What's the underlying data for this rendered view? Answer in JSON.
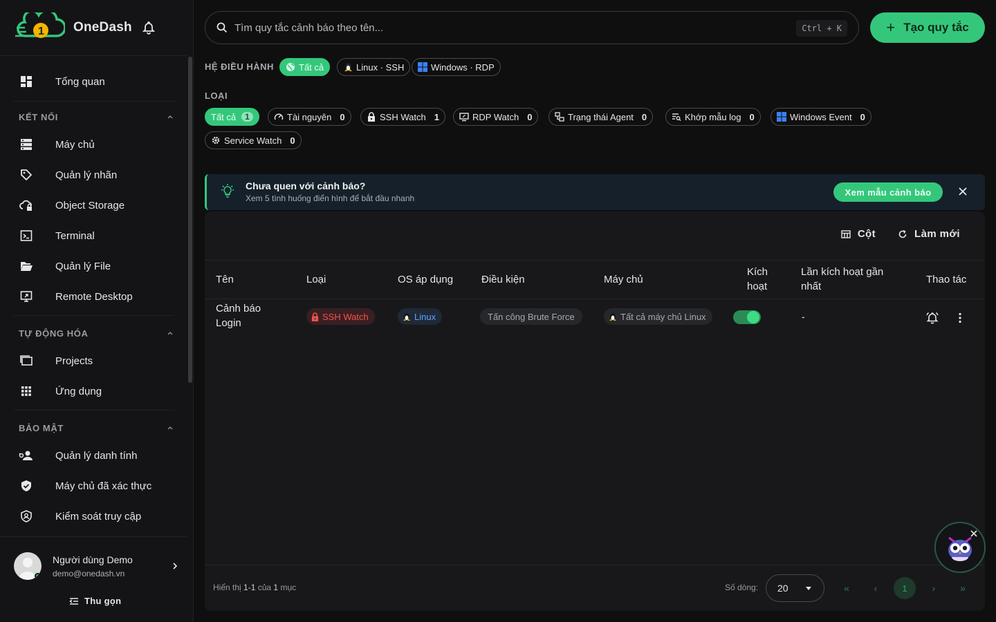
{
  "brand": {
    "name": "OneDash"
  },
  "nav": {
    "overview": "Tổng quan",
    "sections": {
      "connect": "KẾT NỐI",
      "automation": "TỰ ĐỘNG HÓA",
      "security": "BẢO MẬT"
    },
    "connect_items": [
      "Máy chủ",
      "Quản lý nhãn",
      "Object Storage",
      "Terminal",
      "Quản lý File",
      "Remote Desktop"
    ],
    "automation_items": [
      "Projects",
      "Ứng dụng"
    ],
    "security_items": [
      "Quản lý danh tính",
      "Máy chủ đã xác thực",
      "Kiểm soát truy cập"
    ]
  },
  "user": {
    "name": "Người dùng Demo",
    "email": "demo@onedash.vn"
  },
  "collapse_label": "Thu gọn",
  "search": {
    "placeholder": "Tìm quy tắc cảnh báo theo tên...",
    "shortcut": "Ctrl + K"
  },
  "create_button": "Tạo quy tắc",
  "os_filter": {
    "label": "HỆ ĐIỀU HÀNH",
    "options": [
      "Tất cả",
      "Linux · SSH",
      "Windows · RDP"
    ],
    "selected": 0
  },
  "type_filter": {
    "label": "LOẠI",
    "options": [
      {
        "label": "Tất cả",
        "count": "1"
      },
      {
        "label": "Tài nguyên",
        "count": "0"
      },
      {
        "label": "SSH Watch",
        "count": "1"
      },
      {
        "label": "RDP Watch",
        "count": "0"
      },
      {
        "label": "Trạng thái Agent",
        "count": "0"
      },
      {
        "label": "Khớp mẫu log",
        "count": "0"
      },
      {
        "label": "Windows Event",
        "count": "0"
      },
      {
        "label": "Service Watch",
        "count": "0"
      }
    ],
    "selected": 0
  },
  "banner": {
    "title": "Chưa quen với cảnh báo?",
    "subtitle": "Xem 5 tình huống điển hình để bắt đầu nhanh",
    "button": "Xem mẫu cảnh báo"
  },
  "table": {
    "tools": {
      "columns": "Cột",
      "refresh": "Làm mới"
    },
    "headers": {
      "name": "Tên",
      "type": "Loại",
      "os": "OS áp dụng",
      "condition": "Điều kiện",
      "host": "Máy chủ",
      "active_1": "Kích",
      "active_2": "hoạt",
      "last_1": "Lần kích hoạt gần",
      "last_2": "nhất",
      "actions": "Thao tác"
    },
    "rows": [
      {
        "name_1": "Cảnh báo",
        "name_2": "Login",
        "type": "SSH Watch",
        "os": "Linux",
        "condition": "Tấn công Brute Force",
        "host": "Tất cả máy chủ Linux",
        "active": true,
        "last": "-"
      }
    ]
  },
  "footer": {
    "showing_prefix": "Hiển thị",
    "range": "1-1",
    "of": "của",
    "total": "1",
    "unit": "mục",
    "rows_label": "Số dòng:",
    "rows_value": "20",
    "current_page": "1"
  },
  "colors": {
    "accent": "#34c77b",
    "danger": "#ef4444",
    "info": "#3b82f6"
  }
}
